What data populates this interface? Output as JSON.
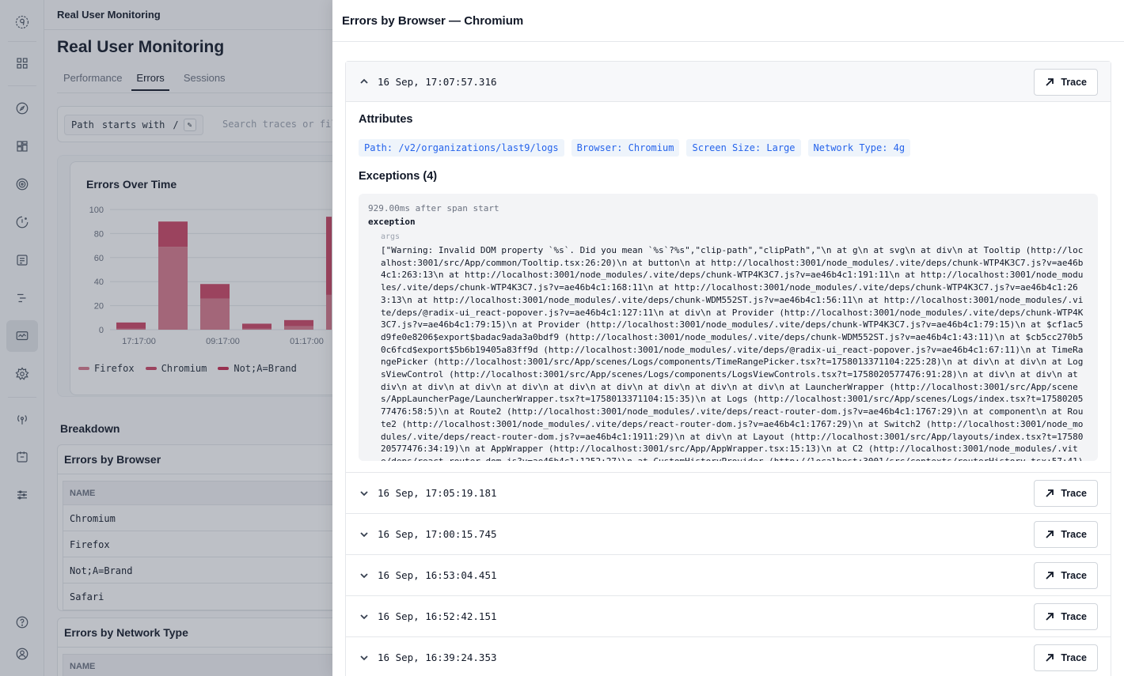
{
  "app": {
    "breadcrumb": "Real User Monitoring",
    "page_title": "Real User Monitoring"
  },
  "tabs": [
    {
      "label": "Performance"
    },
    {
      "label": "Errors"
    },
    {
      "label": "Sessions"
    }
  ],
  "filter": {
    "field": "Path",
    "operator": "starts with",
    "value": "/",
    "search_placeholder": "Search traces or fil"
  },
  "chart": {
    "title": "Errors Over Time"
  },
  "chart_data": {
    "type": "bar",
    "title": "Errors Over Time",
    "categories": [
      "17:17:00",
      "",
      "09:17:00",
      "",
      "01:17:00",
      "",
      ""
    ],
    "x_tick_labels": [
      "17:17:00",
      "09:17:00",
      "01:17:00"
    ],
    "ylim": [
      0,
      100
    ],
    "yticks": [
      0,
      20,
      40,
      60,
      80,
      100
    ],
    "stacked": true,
    "series": [
      {
        "name": "Firefox",
        "color": "#d9798c",
        "values": [
          1,
          69,
          26,
          1,
          3,
          29
        ]
      },
      {
        "name": "Chromium",
        "color": "#cc4565",
        "values": [
          5,
          21,
          12,
          4,
          5,
          65
        ]
      },
      {
        "name": "Not;A=Brand",
        "color": "#c8294f",
        "values": [
          0,
          0,
          0,
          0,
          0,
          0
        ]
      }
    ],
    "legend": "bottom-left",
    "grid": true
  },
  "breakdown": {
    "title": "Breakdown",
    "browser_card": {
      "title": "Errors by Browser",
      "column": "NAME",
      "rows": [
        "Chromium",
        "Firefox",
        "Not;A=Brand",
        "Safari"
      ]
    },
    "network_card": {
      "title": "Errors by Network Type",
      "column": "NAME"
    }
  },
  "drawer": {
    "title": "Errors by Browser — Chromium",
    "trace_label": "Trace",
    "expanded": {
      "time": "16 Sep, 17:07:57.316",
      "attributes_title": "Attributes",
      "attributes": [
        "Path: /v2/organizations/last9/logs",
        "Browser: Chromium",
        "Screen Size: Large",
        "Network Type: 4g"
      ],
      "exceptions_title": "Exceptions (4)",
      "exception": {
        "meta": "929.00ms after span start",
        "name": "exception",
        "arg_label": "args",
        "args": "[\"Warning: Invalid DOM property `%s`. Did you mean `%s`?%s\",\"clip-path\",\"clipPath\",\"\\n at g\\n at svg\\n at div\\n at Tooltip (http://localhost:3001/src/App/common/Tooltip.tsx:26:20)\\n at button\\n at http://localhost:3001/node_modules/.vite/deps/chunk-WTP4K3C7.js?v=ae46b4c1:263:13\\n at http://localhost:3001/node_modules/.vite/deps/chunk-WTP4K3C7.js?v=ae46b4c1:191:11\\n at http://localhost:3001/node_modules/.vite/deps/chunk-WTP4K3C7.js?v=ae46b4c1:168:11\\n at http://localhost:3001/node_modules/.vite/deps/chunk-WTP4K3C7.js?v=ae46b4c1:263:13\\n at http://localhost:3001/node_modules/.vite/deps/chunk-WDM552ST.js?v=ae46b4c1:56:11\\n at http://localhost:3001/node_modules/.vite/deps/@radix-ui_react-popover.js?v=ae46b4c1:127:11\\n at div\\n at Provider (http://localhost:3001/node_modules/.vite/deps/chunk-WTP4K3C7.js?v=ae46b4c1:79:15)\\n at Provider (http://localhost:3001/node_modules/.vite/deps/chunk-WTP4K3C7.js?v=ae46b4c1:79:15)\\n at $cf1ac5d9fe0e8206$export$badac9ada3a0bdf9 (http://localhost:3001/node_modules/.vite/deps/chunk-WDM552ST.js?v=ae46b4c1:43:11)\\n at $cb5cc270b50c6fcd$export$5b6b19405a83ff9d (http://localhost:3001/node_modules/.vite/deps/@radix-ui_react-popover.js?v=ae46b4c1:67:11)\\n at TimeRangePicker (http://localhost:3001/src/App/scenes/Logs/components/TimeRangePicker.tsx?t=1758013371104:225:28)\\n at div\\n at div\\n at LogsViewControl (http://localhost:3001/src/App/scenes/Logs/components/LogsViewControls.tsx?t=1758020577476:91:28)\\n at div\\n at div\\n at div\\n at div\\n at div\\n at div\\n at div\\n at div\\n at div\\n at div\\n at div\\n at LauncherWrapper (http://localhost:3001/src/App/scenes/AppLauncherPage/LauncherWrapper.tsx?t=1758013371104:15:35)\\n at Logs (http://localhost:3001/src/App/scenes/Logs/index.tsx?t=1758020577476:58:5)\\n at Route2 (http://localhost:3001/node_modules/.vite/deps/react-router-dom.js?v=ae46b4c1:1767:29)\\n at component\\n at Route2 (http://localhost:3001/node_modules/.vite/deps/react-router-dom.js?v=ae46b4c1:1767:29)\\n at Switch2 (http://localhost:3001/node_modules/.vite/deps/react-router-dom.js?v=ae46b4c1:1911:29)\\n at div\\n at Layout (http://localhost:3001/src/App/layouts/index.tsx?t=1758020577476:34:19)\\n at AppWrapper (http://localhost:3001/src/App/AppWrapper.tsx:15:13)\\n at C2 (http://localhost:3001/node_modules/.vite/deps/react-router-dom.js?v=ae46b4c1:1252:27)\\n at CustomHistoryProvider (http://localhost:3001/src/contexts/routerHistory.tsx:57:41)\\n at Tim"
      }
    },
    "collapsed": [
      {
        "time": "16 Sep, 17:05:19.181"
      },
      {
        "time": "16 Sep, 17:00:15.745"
      },
      {
        "time": "16 Sep, 16:53:04.451"
      },
      {
        "time": "16 Sep, 16:52:42.151"
      },
      {
        "time": "16 Sep, 16:39:24.353"
      }
    ]
  },
  "sidebar": {
    "icons": [
      "logo-icon",
      "dashboard-icon",
      "explore-icon",
      "apps-icon",
      "target-icon",
      "alert-icon",
      "logs-icon",
      "traces-icon",
      "rum-icon",
      "settings-gear-icon",
      "signal-icon",
      "integrations-icon",
      "sliders-icon",
      "help-icon",
      "user-icon"
    ]
  }
}
